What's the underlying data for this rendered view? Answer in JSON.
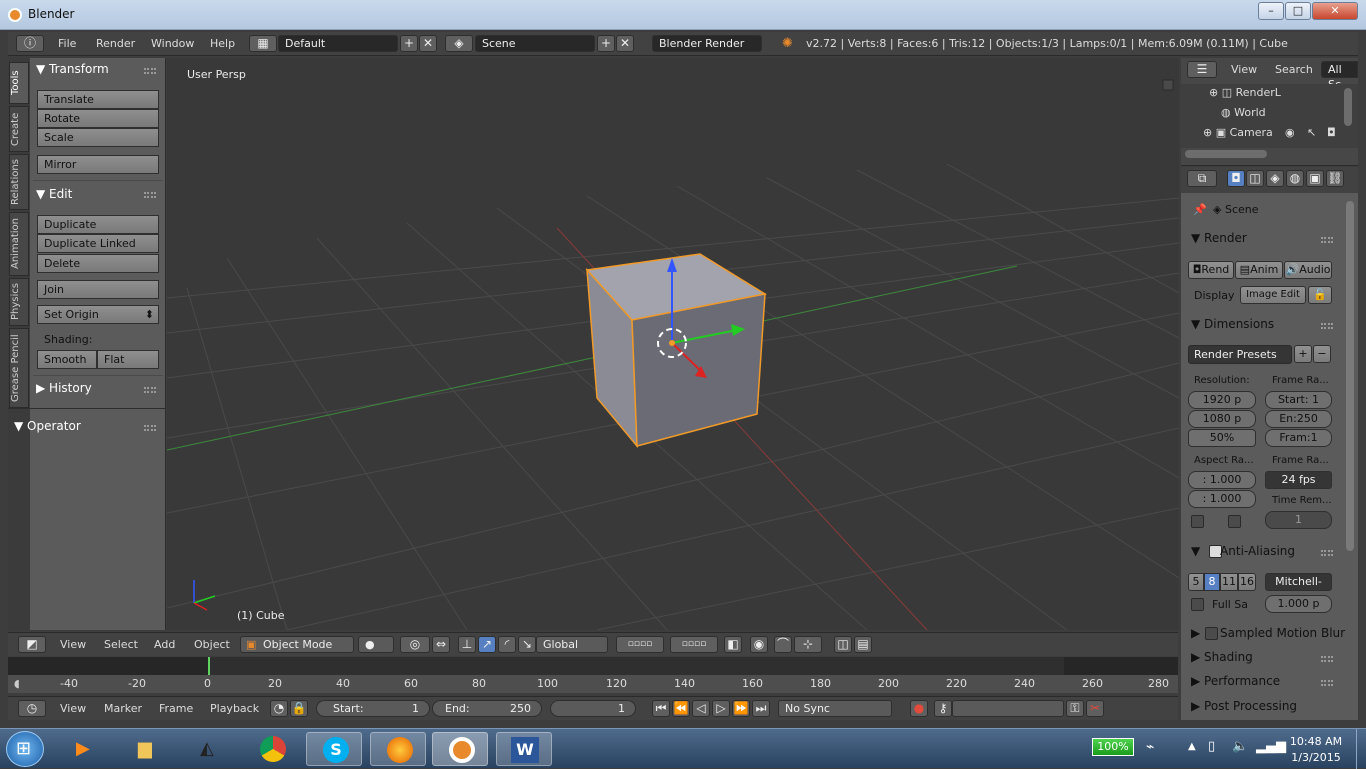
{
  "window": {
    "title": "Blender"
  },
  "info_header": {
    "menus": [
      "File",
      "Render",
      "Window",
      "Help"
    ],
    "layout": "Default",
    "scene": "Scene",
    "engine": "Blender Render",
    "stats": "v2.72 | Verts:8 | Faces:6 | Tris:12 | Objects:1/3 | Lamps:0/1 | Mem:6.09M (0.11M) | Cube"
  },
  "tool_tabs": [
    "Tools",
    "Create",
    "Relations",
    "Animation",
    "Physics",
    "Grease Pencil"
  ],
  "tool_panel": {
    "transform_header": "Transform",
    "translate": "Translate",
    "rotate": "Rotate",
    "scale": "Scale",
    "mirror": "Mirror",
    "edit_header": "Edit",
    "duplicate": "Duplicate",
    "duplicate_linked": "Duplicate Linked",
    "delete": "Delete",
    "join": "Join",
    "set_origin": "Set Origin",
    "shading_label": "Shading:",
    "smooth": "Smooth",
    "flat": "Flat",
    "history_header": "History",
    "operator_header": "Operator"
  },
  "viewport": {
    "view_label": "User Persp",
    "object_label": "(1) Cube"
  },
  "view_header": {
    "menus": [
      "View",
      "Select",
      "Add",
      "Object"
    ],
    "mode": "Object Mode",
    "orientation": "Global"
  },
  "timeline": {
    "ticks": [
      "-40",
      "-20",
      "0",
      "20",
      "40",
      "60",
      "80",
      "100",
      "120",
      "140",
      "160",
      "180",
      "200",
      "220",
      "240",
      "260",
      "280"
    ],
    "menus": [
      "View",
      "Marker",
      "Frame",
      "Playback"
    ],
    "start_label": "Start:",
    "start_value": "1",
    "end_label": "End:",
    "end_value": "250",
    "current_frame": "1",
    "sync": "No Sync"
  },
  "outliner": {
    "menus": [
      "View",
      "Search",
      "All Sc"
    ],
    "items": [
      "RenderL",
      "World",
      "Camera"
    ]
  },
  "properties": {
    "scene": "Scene",
    "render_header": "Render",
    "render_btn": "Rend",
    "anim_btn": "Anim",
    "audio_btn": "Audio",
    "display_label": "Display",
    "display_value": "Image Edit",
    "dimensions_header": "Dimensions",
    "render_presets": "Render Presets",
    "resolution_label": "Resolution:",
    "res_x": "1920 p",
    "res_y": "1080 p",
    "res_pct": "50%",
    "frame_range_label": "Frame Ra...",
    "frame_start": "Start: 1",
    "frame_end": "En:250",
    "frame_step": "Fram:1",
    "aspect_label": "Aspect Ra...",
    "aspect_x": ": 1.000",
    "aspect_y": ": 1.000",
    "frame_rate_label": "Frame Ra...",
    "fps": "24 fps",
    "time_remap_label": "Time Rem...",
    "time_remap_value": "1",
    "aa_header": "Anti-Aliasing",
    "aa_samples": [
      "5",
      "8",
      "11",
      "16"
    ],
    "aa_filter": "Mitchell-",
    "full_sample": "Full Sa",
    "filter_size": "1.000 p",
    "motion_blur": "Sampled Motion Blur",
    "shading_header": "Shading",
    "performance_header": "Performance",
    "post_header": "Post Processing"
  },
  "taskbar": {
    "battery": "100%",
    "time": "10:48 AM",
    "date": "1/3/2015"
  }
}
